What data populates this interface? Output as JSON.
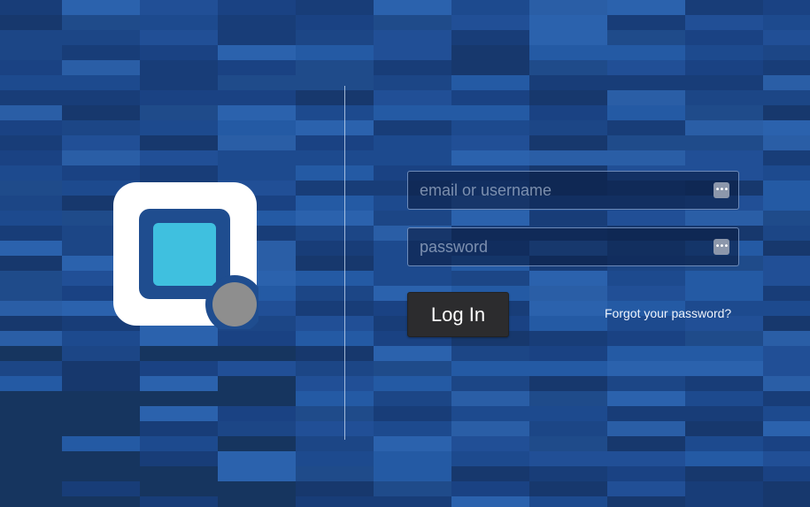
{
  "login": {
    "username_placeholder": "email or username",
    "username_value": "",
    "password_placeholder": "password",
    "password_value": "",
    "field_icon": "password-manager-icon",
    "login_button_label": "Log In",
    "forgot_password_link": "Forgot your password?"
  },
  "logo": {
    "icon": "app-logo-icon"
  },
  "colors": {
    "background": "#1f4d92",
    "logo_outer": "#ffffff",
    "logo_frame": "#1f4d8f",
    "logo_square": "#3fc0df",
    "logo_dot": "#8e8e8e",
    "button": "#2c2c2e",
    "field_bg": "#0c1e46"
  }
}
